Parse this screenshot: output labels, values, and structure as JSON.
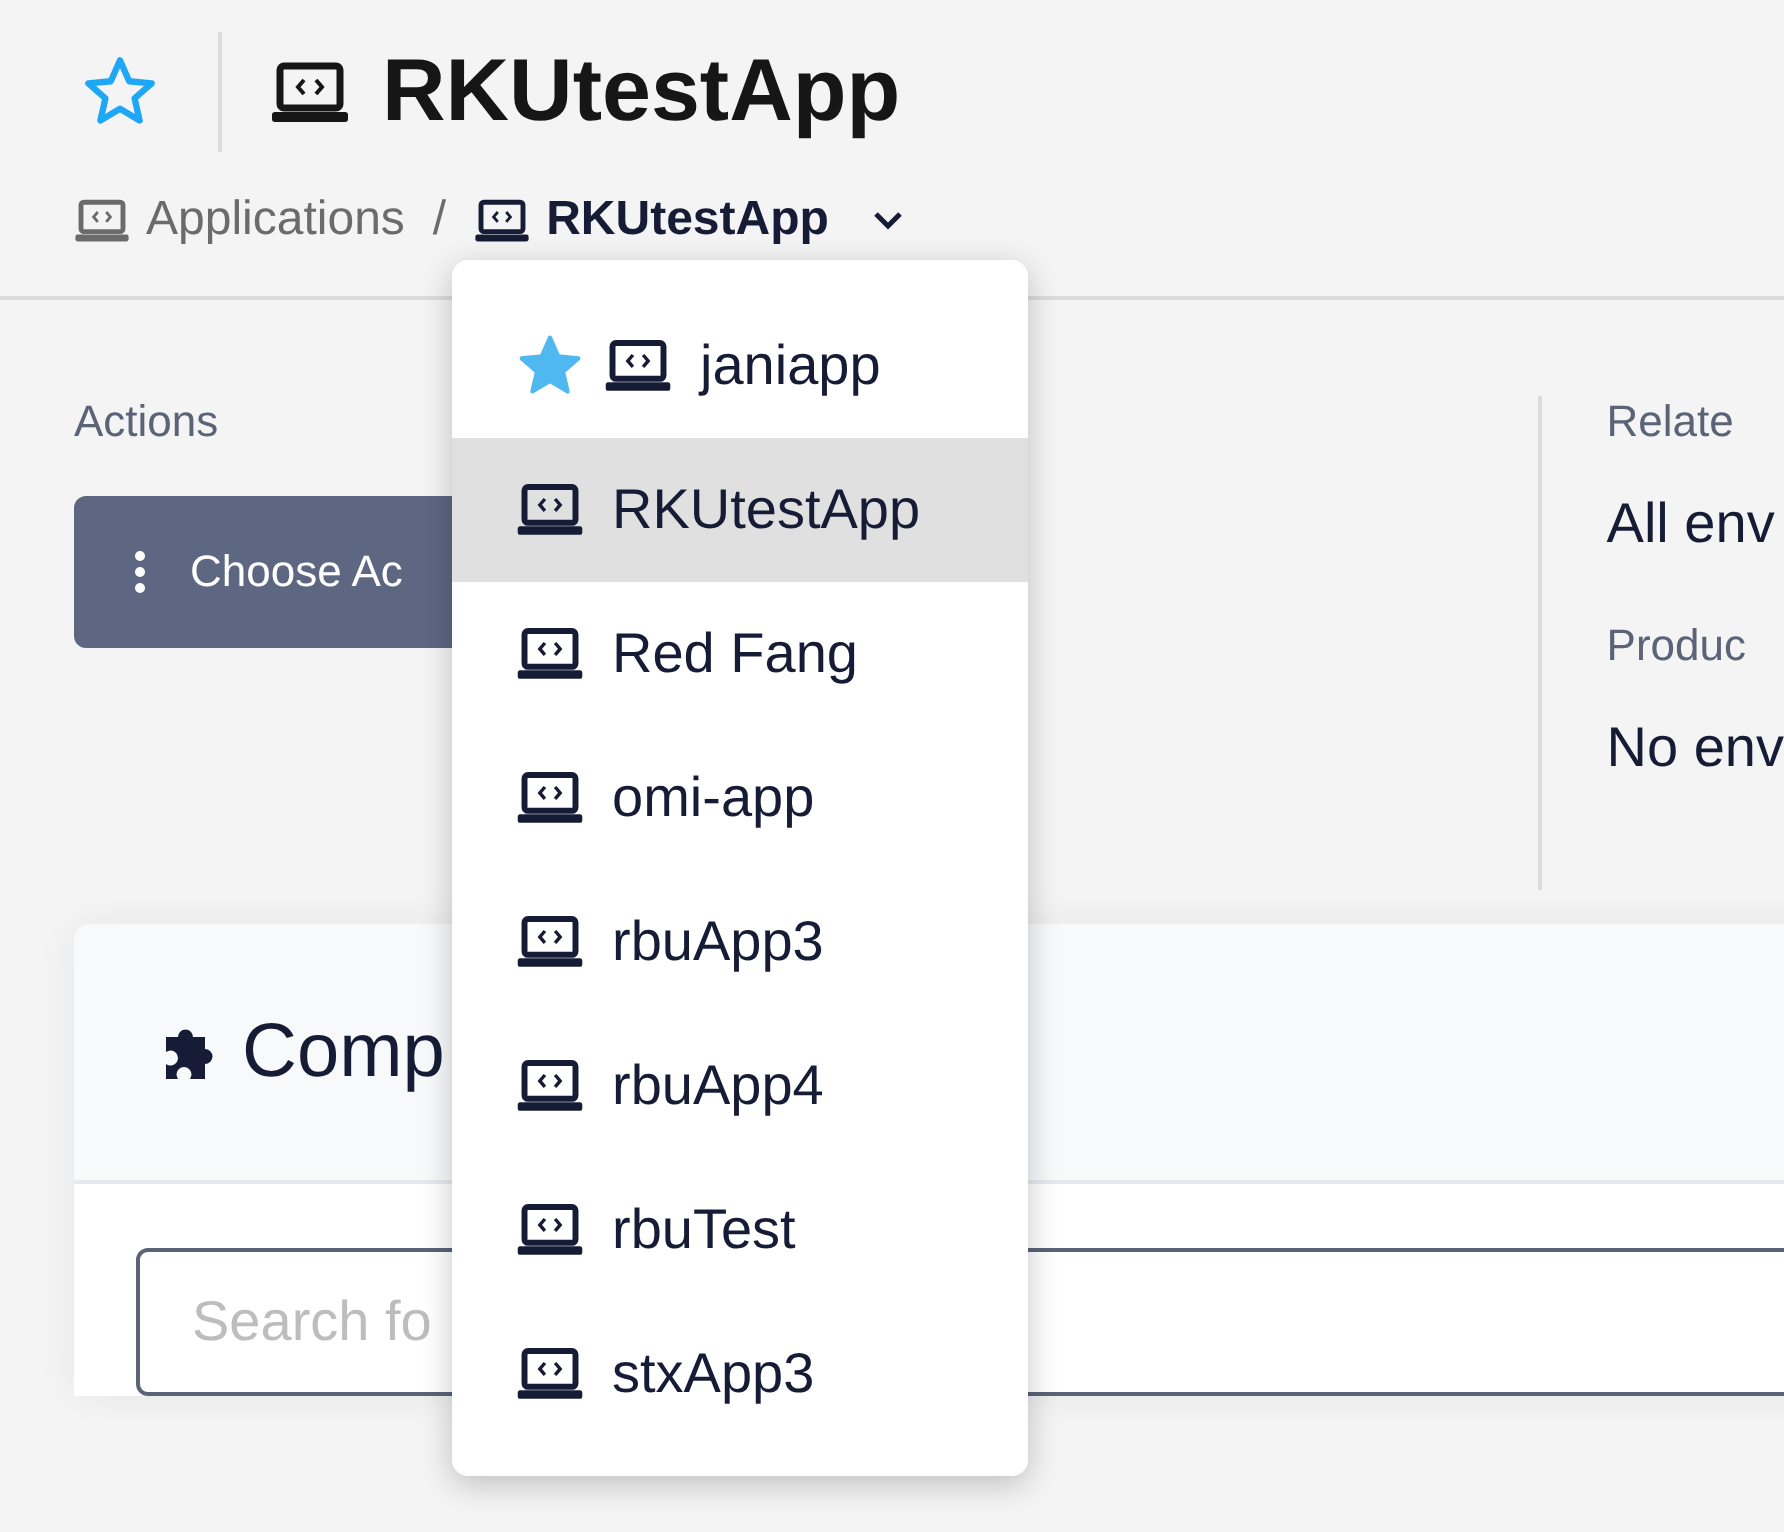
{
  "header": {
    "favorite": false,
    "title": "RKUtestApp",
    "breadcrumb": [
      {
        "label": "Applications",
        "current": false
      },
      {
        "label": "RKUtestApp",
        "current": true
      }
    ],
    "separator": "/"
  },
  "actions": {
    "label": "Actions",
    "button": "Choose Ac"
  },
  "related": [
    {
      "label": "Relate",
      "value": "All env"
    },
    {
      "label": "Produc",
      "value": "No env"
    }
  ],
  "card": {
    "title": "Comp",
    "search": {
      "placeholder": "Search fo"
    }
  },
  "dropdown": [
    {
      "label": "janiapp",
      "favorite": true,
      "selected": false
    },
    {
      "label": "RKUtestApp",
      "favorite": false,
      "selected": true
    },
    {
      "label": "Red Fang",
      "favorite": false,
      "selected": false
    },
    {
      "label": "omi-app",
      "favorite": false,
      "selected": false
    },
    {
      "label": "rbuApp3",
      "favorite": false,
      "selected": false
    },
    {
      "label": "rbuApp4",
      "favorite": false,
      "selected": false
    },
    {
      "label": "rbuTest",
      "favorite": false,
      "selected": false
    },
    {
      "label": "stxApp3",
      "favorite": false,
      "selected": false
    }
  ]
}
